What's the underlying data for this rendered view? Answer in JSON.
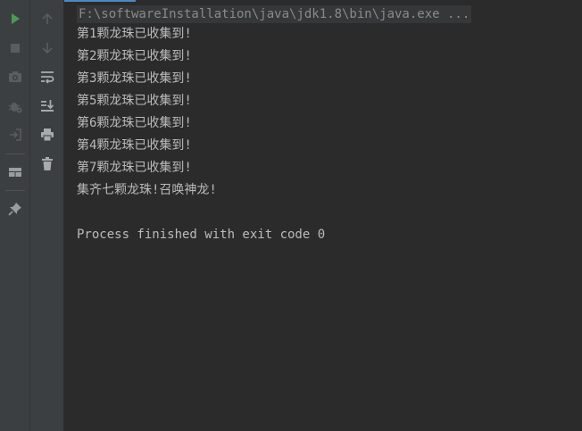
{
  "command_line": "F:\\softwareInstallation\\java\\jdk1.8\\bin\\java.exe ...",
  "output_lines": [
    "第1颗龙珠已收集到!",
    "第2颗龙珠已收集到!",
    "第3颗龙珠已收集到!",
    "第5颗龙珠已收集到!",
    "第6颗龙珠已收集到!",
    "第4颗龙珠已收集到!",
    "第7颗龙珠已收集到!",
    "集齐七颗龙珠!召唤神龙!"
  ],
  "exit_message": "Process finished with exit code 0",
  "toolbar_left": [
    "run-icon",
    "stop-icon",
    "camera-icon",
    "debug-settings-icon",
    "login-icon",
    "layout-icon",
    "pin-icon"
  ],
  "toolbar_right": [
    "arrow-up-icon",
    "arrow-down-icon",
    "soft-wrap-icon",
    "scroll-to-end-icon",
    "print-icon",
    "trash-icon"
  ],
  "colors": {
    "background": "#2b2b2b",
    "toolbar": "#3c3f41",
    "text": "#bbbbbb",
    "run_green": "#499c54",
    "accent": "#4a88c7"
  }
}
